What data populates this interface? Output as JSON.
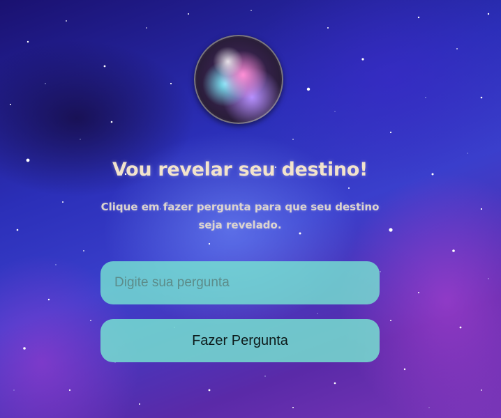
{
  "hero": {
    "title": "Vou revelar seu destino!",
    "subtitle": "Clique em fazer pergunta para que seu destino seja revelado."
  },
  "form": {
    "question_placeholder": "Digite sua pergunta",
    "question_value": "",
    "ask_label": "Fazer Pergunta"
  },
  "images": {
    "orb_icon": "crystal-ball-icon",
    "background": "galaxy-starfield"
  },
  "colors": {
    "accent": "#78ebd2",
    "title_text": "#f2e3cc",
    "subtitle_text": "#dcd4cf",
    "background_primary": "#2b2fb8",
    "background_secondary": "#7a36b8"
  }
}
